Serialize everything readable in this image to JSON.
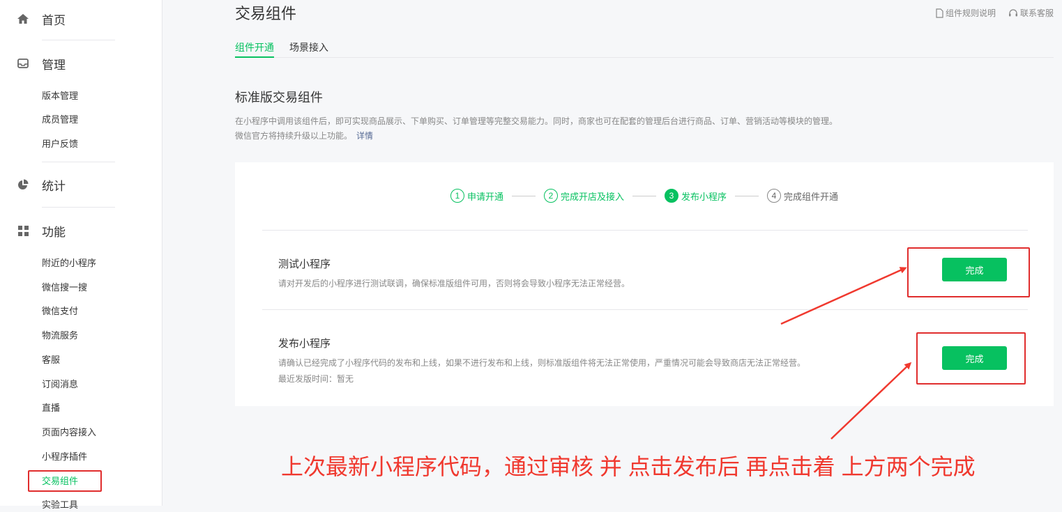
{
  "sidebar": {
    "home": "首页",
    "manage": "管理",
    "manage_items": [
      "版本管理",
      "成员管理",
      "用户反馈"
    ],
    "stats": "统计",
    "features": "功能",
    "feature_items": [
      "附近的小程序",
      "微信搜一搜",
      "微信支付",
      "物流服务",
      "客服",
      "订阅消息",
      "直播",
      "页面内容接入",
      "小程序插件",
      "交易组件",
      "实验工具"
    ]
  },
  "header": {
    "title": "交易组件",
    "rules_link": "组件规则说明",
    "support_link": "联系客服"
  },
  "tabs": [
    "组件开通",
    "场景接入"
  ],
  "section": {
    "title": "标准版交易组件",
    "desc_line1": "在小程序中调用该组件后，即可实现商品展示、下单购买、订单管理等完整交易能力。同时，商家也可在配套的管理后台进行商品、订单、营销活动等模块的管理。",
    "desc_line2": "微信官方将持续升级以上功能。",
    "detail_link": "详情"
  },
  "steps": [
    {
      "num": "1",
      "label": "申请开通"
    },
    {
      "num": "2",
      "label": "完成开店及接入"
    },
    {
      "num": "3",
      "label": "发布小程序"
    },
    {
      "num": "4",
      "label": "完成组件开通"
    }
  ],
  "rows": [
    {
      "title": "测试小程序",
      "desc": "请对开发后的小程序进行测试联调，确保标准版组件可用，否则将会导致小程序无法正常经营。",
      "button": "完成"
    },
    {
      "title": "发布小程序",
      "desc": "请确认已经完成了小程序代码的发布和上线，如果不进行发布和上线，则标准版组件将无法正常使用，严重情况可能会导致商店无法正常经营。",
      "extra": "最近发版时间：暂无",
      "button": "完成"
    }
  ],
  "annotation": "上次最新小程序代码，通过审核 并 点击发布后 再点击着 上方两个完成",
  "colors": {
    "accent": "#07c160",
    "highlight": "#e02d2d",
    "link": "#576b95"
  }
}
